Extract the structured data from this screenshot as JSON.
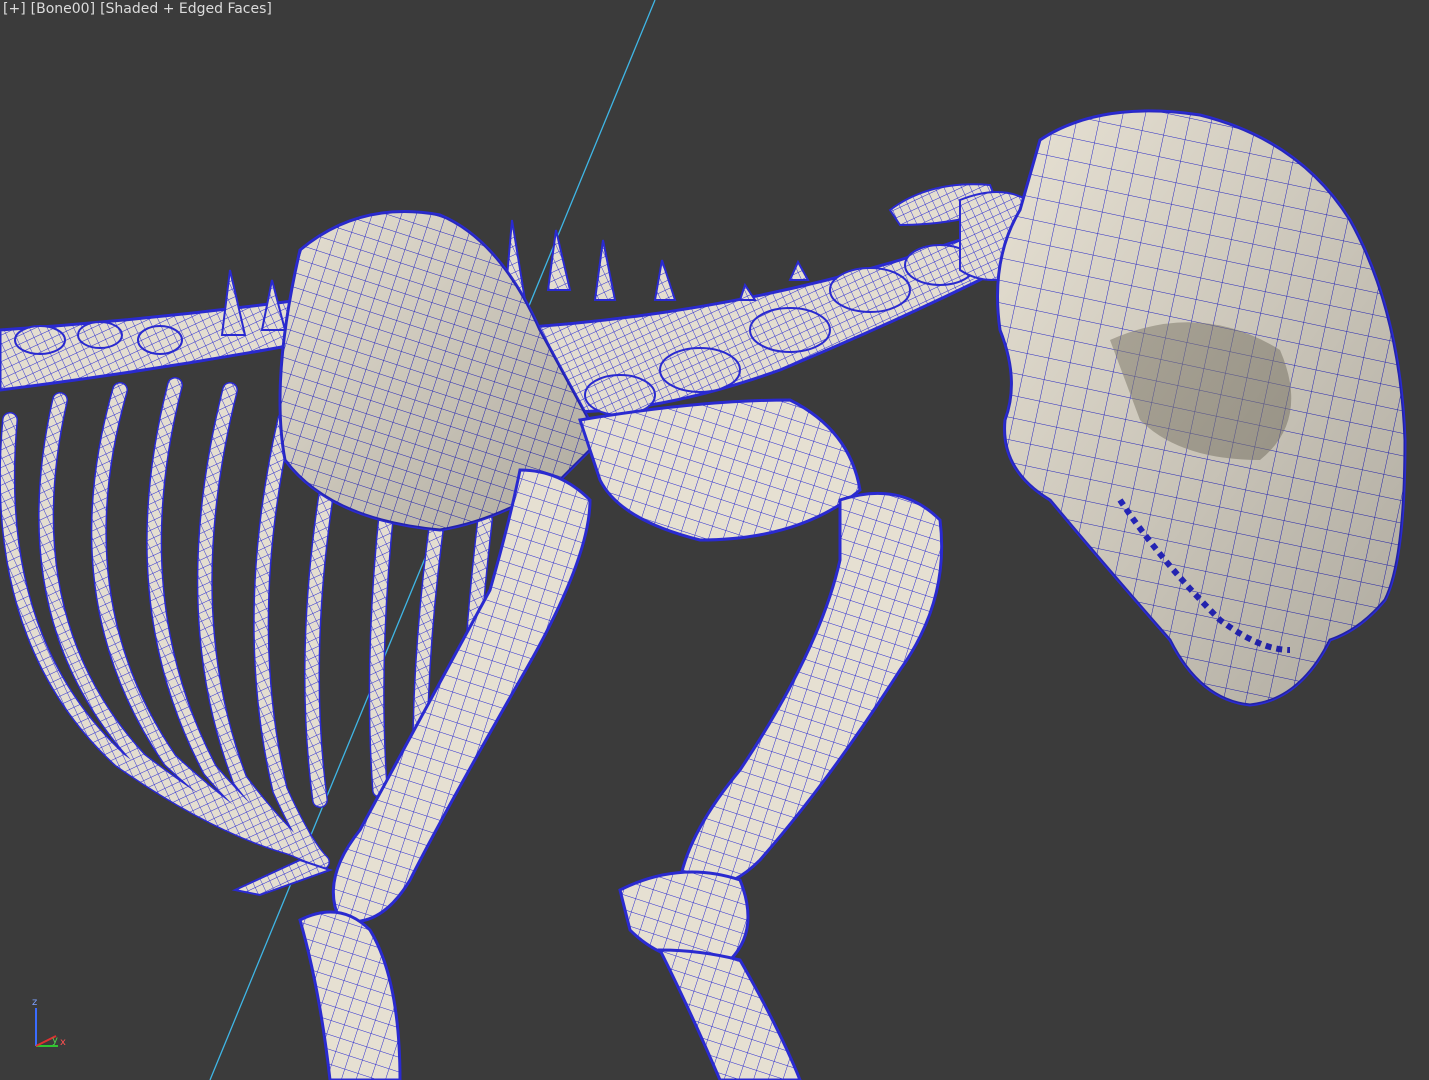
{
  "viewport": {
    "labels": {
      "menu": "[+]",
      "camera": "[Bone00]",
      "shading": "[Shaded + Edged Faces]"
    },
    "background_color": "#3b3b3b",
    "wire_color": "#2a2ad0",
    "bone_color": "#e6e0d2",
    "axis": {
      "z_label": "z",
      "y_label": "y",
      "x_label": "x",
      "z_color": "#3a6cff",
      "y_color": "#2fc52f",
      "x_color": "#e03030"
    }
  }
}
